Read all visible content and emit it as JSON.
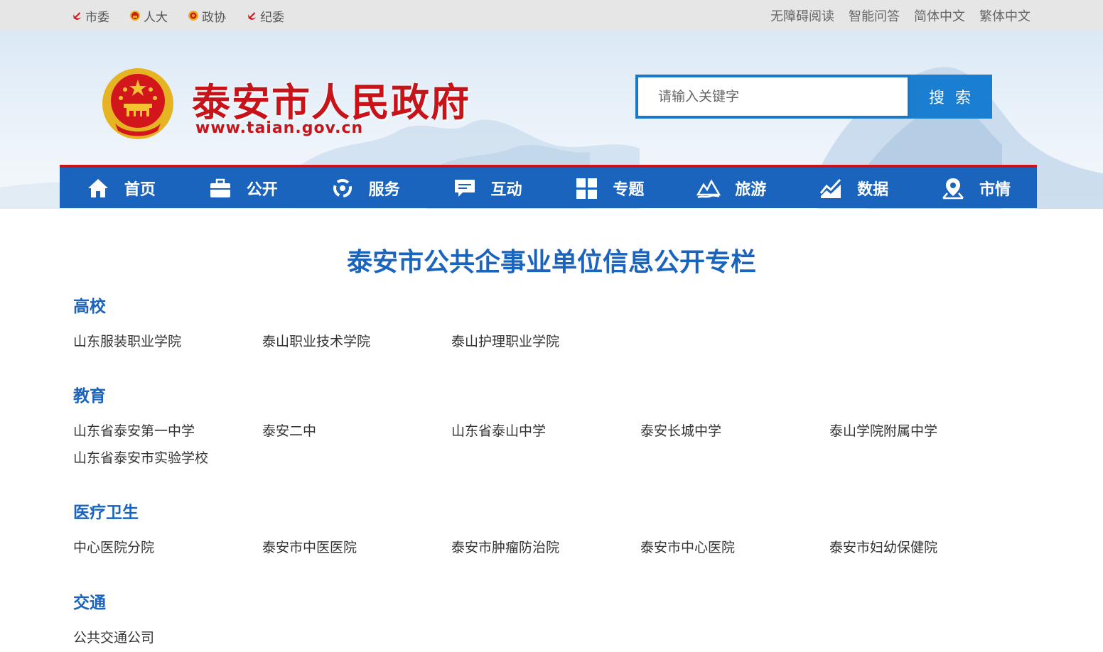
{
  "topbar": {
    "left": [
      {
        "label": "市委",
        "icon": "party-emblem-icon"
      },
      {
        "label": "人大",
        "icon": "national-emblem-icon"
      },
      {
        "label": "政协",
        "icon": "cppcc-emblem-icon"
      },
      {
        "label": "纪委",
        "icon": "party-emblem-icon"
      }
    ],
    "right": [
      "无障碍阅读",
      "智能问答",
      "简体中文",
      "繁体中文"
    ]
  },
  "header": {
    "title": "泰安市人民政府",
    "url": "www.taian.gov.cn",
    "search_placeholder": "请输入关键字",
    "search_button": "搜 索"
  },
  "nav": [
    {
      "label": "首页",
      "icon": "home-icon"
    },
    {
      "label": "公开",
      "icon": "briefcase-icon"
    },
    {
      "label": "服务",
      "icon": "service-icon"
    },
    {
      "label": "互动",
      "icon": "chat-icon"
    },
    {
      "label": "专题",
      "icon": "grid-icon"
    },
    {
      "label": "旅游",
      "icon": "mountain-icon"
    },
    {
      "label": "数据",
      "icon": "chart-icon"
    },
    {
      "label": "市情",
      "icon": "location-icon"
    }
  ],
  "main": {
    "title": "泰安市公共企事业单位信息公开专栏",
    "sections": [
      {
        "heading": "高校",
        "links": [
          "山东服装职业学院",
          "泰山职业技术学院",
          "泰山护理职业学院"
        ]
      },
      {
        "heading": "教育",
        "links": [
          "山东省泰安第一中学",
          "泰安二中",
          "山东省泰山中学",
          "泰安长城中学",
          "泰山学院附属中学",
          "山东省泰安市实验学校"
        ]
      },
      {
        "heading": "医疗卫生",
        "links": [
          "中心医院分院",
          "泰安市中医医院",
          "泰安市肿瘤防治院",
          "泰安市中心医院",
          "泰安市妇幼保健院"
        ]
      },
      {
        "heading": "交通",
        "links": [
          "公共交通公司"
        ]
      }
    ]
  },
  "colors": {
    "brand_red": "#c7141a",
    "brand_blue": "#1b64bd",
    "search_blue": "#1b7fd1"
  }
}
